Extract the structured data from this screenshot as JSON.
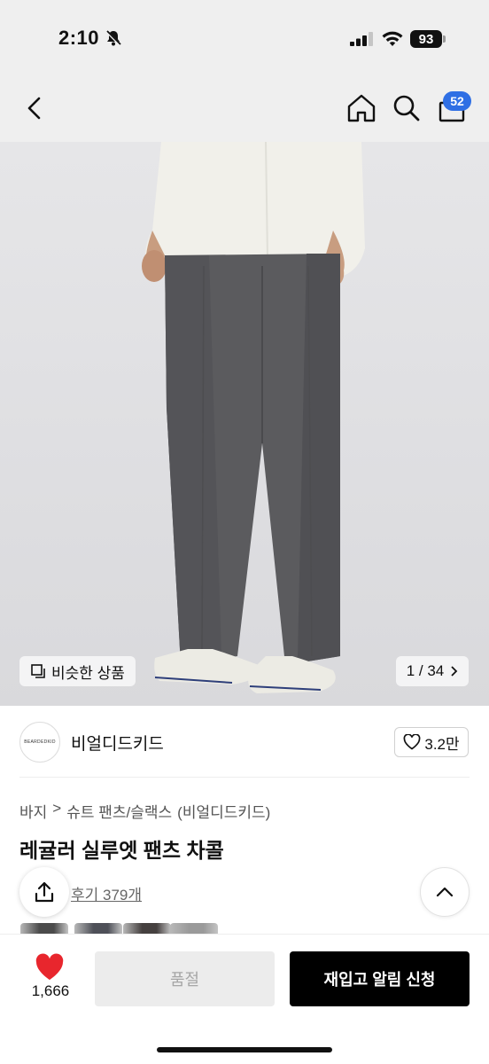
{
  "status_bar": {
    "time": "2:10",
    "battery": "93"
  },
  "nav": {
    "cart_count": "52"
  },
  "gallery": {
    "similar_label": "비슷한 상품",
    "page_indicator": "1 / 34"
  },
  "brand": {
    "logo_text": "BEARDEDKID",
    "name": "비얼디드키드",
    "likes": "3.2만"
  },
  "product": {
    "breadcrumb": [
      "바지",
      ">",
      "슈트 팬츠/슬랙스",
      "(비얼디드키드)"
    ],
    "title": "레귤러 실루엣 팬츠 차콜",
    "reviews": "후기 379개"
  },
  "thumbnails": [
    "#4b4b4b",
    "#4e5058",
    "#45403f",
    "#9a9a9a"
  ],
  "bottom": {
    "like_count": "1,666",
    "soldout_label": "품절",
    "restock_label": "재입고 알림 신청"
  },
  "colors": {
    "accent_badge": "#2f6fe4",
    "heart": "#e8262d"
  }
}
